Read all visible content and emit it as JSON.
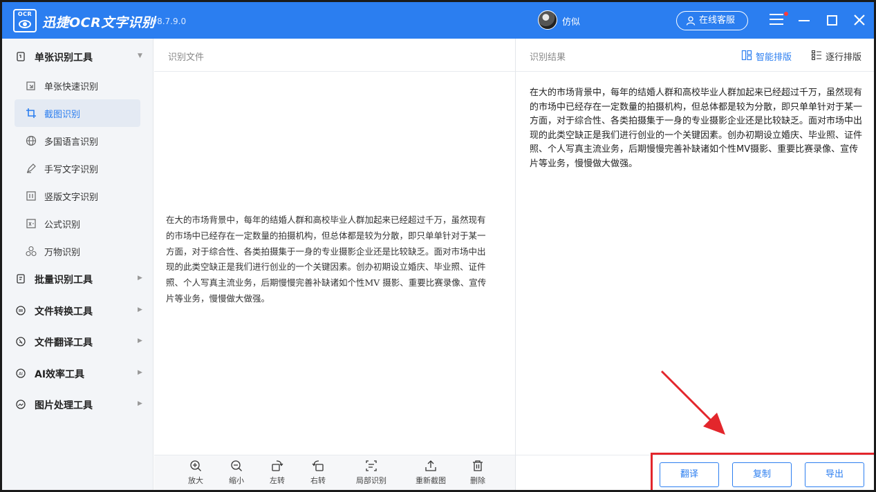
{
  "app": {
    "logo_text": "OCR",
    "name": "迅捷OCR文字识别",
    "version": "v8.7.9.0",
    "accent_color": "#2b7ef0"
  },
  "header": {
    "user_name": "仿似",
    "service_label": "在线客服"
  },
  "sidebar": {
    "groups": [
      {
        "label": "单张识别工具",
        "icon": "single-doc-icon",
        "expanded": true
      },
      {
        "label": "批量识别工具",
        "icon": "batch-icon"
      },
      {
        "label": "文件转换工具",
        "icon": "convert-icon"
      },
      {
        "label": "文件翻译工具",
        "icon": "translate-icon"
      },
      {
        "label": "AI效率工具",
        "icon": "ai-icon"
      },
      {
        "label": "图片处理工具",
        "icon": "image-process-icon"
      }
    ],
    "items": [
      {
        "label": "单张快速识别",
        "icon": "quick-scan-icon"
      },
      {
        "label": "截图识别",
        "icon": "crop-icon",
        "active": true
      },
      {
        "label": "多国语言识别",
        "icon": "globe-icon"
      },
      {
        "label": "手写文字识别",
        "icon": "pen-icon"
      },
      {
        "label": "竖版文字识别",
        "icon": "vertical-text-icon"
      },
      {
        "label": "公式识别",
        "icon": "formula-icon"
      },
      {
        "label": "万物识别",
        "icon": "objects-icon"
      }
    ]
  },
  "left_panel": {
    "title": "识别文件",
    "document_text": "在大的市场背景中，每年的结婚人群和高校毕业人群加起来已经超过千万，虽然现有的市场中已经存在一定数量的拍摄机构，但总体都是较为分散，即只单单针对于某一方面，对于综合性、各类拍摄集于一身的专业摄影企业还是比较缺乏。面对市场中出现的此类空缺正是我们进行创业的一个关键因素。创办初期设立婚庆、毕业照、证件照、个人写真主流业务，后期慢慢完善补缺诸如个性MV 摄影、重要比赛录像、宣传片等业务，慢慢做大做强。"
  },
  "right_panel": {
    "title": "识别结果",
    "smart_layout_label": "智能排版",
    "line_layout_label": "逐行排版",
    "result_text": "在大的市场背景中，每年的结婚人群和高校毕业人群加起来已经超过千万，虽然现有的市场中已经存在一定数量的拍摄机构，但总体都是较为分散，即只单单针对于某一方面，对于综合性、各类拍摄集于一身的专业摄影企业还是比较缺乏。面对市场中出现的此类空缺正是我们进行创业的一个关键因素。创办初期设立婚庆、毕业照、证件照、个人写真主流业务，后期慢慢完善补缺诸如个性MV摄影、重要比赛录像、宣传片等业务，慢慢做大做强。"
  },
  "toolbar": {
    "zoom_in": "放大",
    "zoom_out": "缩小",
    "rotate_left": "左转",
    "rotate_right": "右转",
    "partial_ocr": "局部识别",
    "recapture": "重新截图",
    "delete": "删除"
  },
  "actions": {
    "translate": "翻译",
    "copy": "复制",
    "export": "导出"
  },
  "annotation": {
    "highlight_color": "#e3262c"
  }
}
